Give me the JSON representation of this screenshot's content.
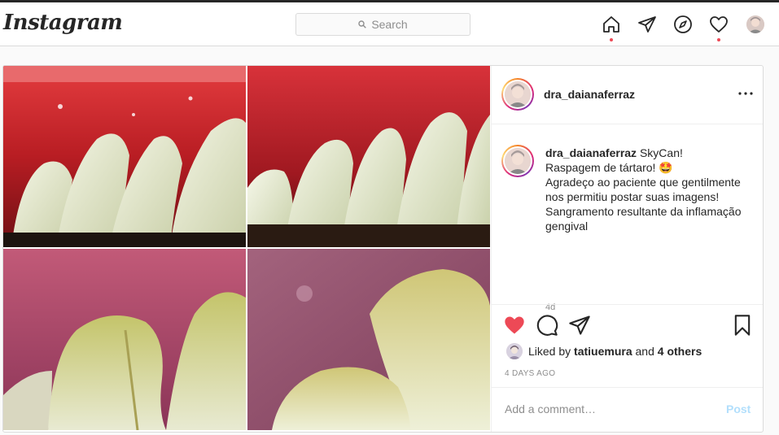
{
  "app": {
    "logo": "Instagram"
  },
  "search": {
    "placeholder": "Search"
  },
  "nav": {
    "items": [
      {
        "icon": "home-icon",
        "active": true
      },
      {
        "icon": "direct-send-icon"
      },
      {
        "icon": "explore-compass-icon"
      },
      {
        "icon": "activity-heart-icon",
        "notification": true
      },
      {
        "icon": "profile-avatar"
      }
    ]
  },
  "post": {
    "author": "dra_daianaferraz",
    "caption": {
      "username": "dra_daianaferraz",
      "lines": [
        "SkyCan!",
        "Raspagem de tártaro! 🤩",
        "Agradeço ao paciente que gentilmente nos permitiu postar suas imagens!",
        "Sangramento resultante da inflamação gengival"
      ]
    },
    "caption_time": "4d",
    "liked": true,
    "likes": {
      "prefix": "Liked by",
      "user": "tatiuemura",
      "and": "and",
      "others": "4 others"
    },
    "date": "4 DAYS AGO",
    "comment": {
      "placeholder": "Add a comment…",
      "post_label": "Post"
    }
  },
  "colors": {
    "like_red": "#ed4956",
    "post_disabled": "#b2dffc",
    "notification_dot": "#ed4956"
  }
}
